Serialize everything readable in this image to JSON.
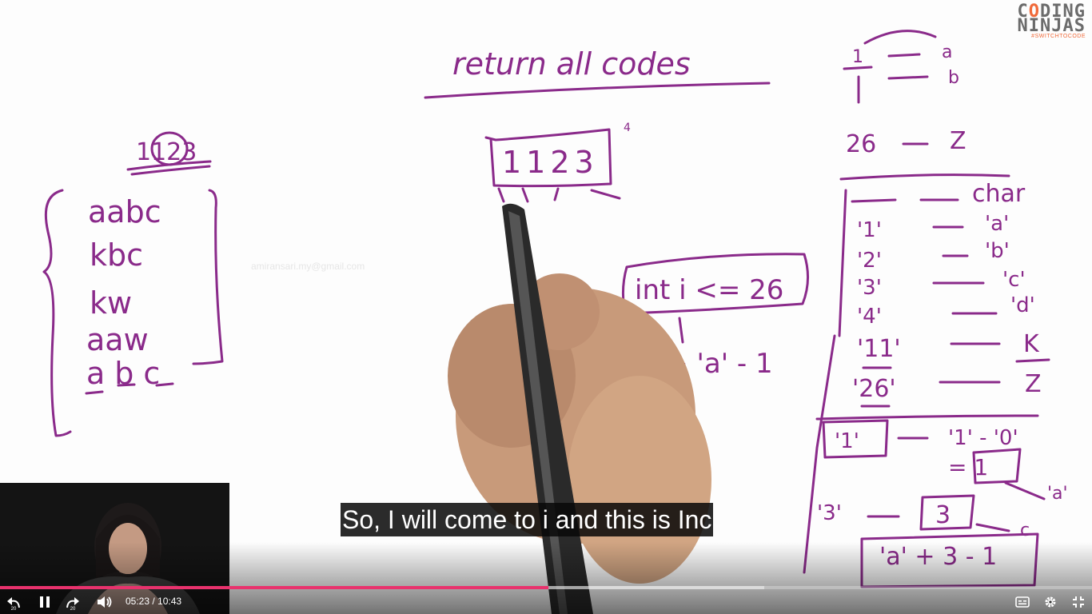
{
  "logo": {
    "line1": "CODING",
    "line2": "NINJAS",
    "tagline": "#SWITCHTOCODE"
  },
  "watermark": "amiransari.my@gmail.com",
  "board": {
    "title": "return all codes",
    "input_digits": "1123",
    "left_outputs": [
      "aabc",
      "kbc",
      "kw",
      "aaw",
      "abc"
    ],
    "right_mapping_header": "char",
    "right_mapping": [
      {
        "from": "'1'",
        "to": "'a'"
      },
      {
        "from": "'2'",
        "to": "'b'"
      },
      {
        "from": "'3'",
        "to": "'c'"
      },
      {
        "from": "'4'",
        "to": "'d'"
      },
      {
        "from": "'11'",
        "to": "K"
      },
      {
        "from": "'26'",
        "to": "Z"
      }
    ],
    "formula_box": "int i <= 26",
    "formula_result": "i + 'a' - 1",
    "char_arith": "'1' - '0'",
    "char_eq": "= 1",
    "final_expr": "'a' + 3 - 1"
  },
  "caption": "So, I will come to i and this is Inc",
  "player": {
    "current_time": "05:23",
    "duration": "10:43",
    "time_display": "05:23 / 10:43",
    "played_fraction": 0.502,
    "buffered_fraction": 0.7,
    "skip_seconds": "20",
    "accent_color": "#e8326d",
    "icons": [
      "rewind-20-icon",
      "pause-icon",
      "forward-20-icon",
      "volume-icon",
      "captions-icon",
      "settings-gear-icon",
      "exit-fullscreen-icon"
    ]
  }
}
